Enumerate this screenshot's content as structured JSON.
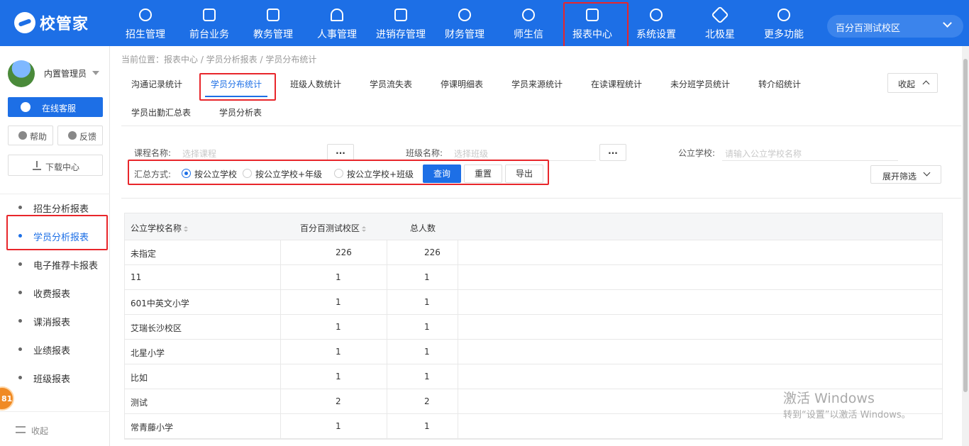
{
  "app": {
    "logo_text": "校管家",
    "campus": "百分百测试校区"
  },
  "nav": [
    {
      "label": "招生管理",
      "icon": "user-plus-icon"
    },
    {
      "label": "前台业务",
      "icon": "desk-icon"
    },
    {
      "label": "教务管理",
      "icon": "book-icon"
    },
    {
      "label": "人事管理",
      "icon": "person-icon"
    },
    {
      "label": "进销存管理",
      "icon": "inventory-icon"
    },
    {
      "label": "财务管理",
      "icon": "money-icon"
    },
    {
      "label": "师生信",
      "icon": "message-icon"
    },
    {
      "label": "报表中心",
      "icon": "report-icon"
    },
    {
      "label": "系统设置",
      "icon": "settings-icon"
    },
    {
      "label": "北极星",
      "icon": "star-icon"
    },
    {
      "label": "更多功能",
      "icon": "more-icon"
    }
  ],
  "sidebar": {
    "user": "内置管理员",
    "online_service": "在线客服",
    "help": "帮助",
    "feedback": "反馈",
    "download_center": "下载中心",
    "items": [
      "招生分析报表",
      "学员分析报表",
      "电子推荐卡报表",
      "收费报表",
      "课消报表",
      "业绩报表",
      "班级报表"
    ],
    "collapse": "收起",
    "badge": "81"
  },
  "breadcrumb": "当前位置：报表中心 / 学员分析报表 / 学员分布统计",
  "tabs": [
    "沟通记录统计",
    "学员分布统计",
    "班级人数统计",
    "学员流失表",
    "停课明细表",
    "学员来源统计",
    "在读课程统计",
    "未分班学员统计",
    "转介绍统计",
    "学员出勤汇总表",
    "学员分析表"
  ],
  "collapse_label": "收起",
  "filters": {
    "course_label": "课程名称:",
    "course_placeholder": "选择课程",
    "class_label": "班级名称:",
    "class_placeholder": "选择班级",
    "school_label": "公立学校:",
    "school_placeholder": "请输入公立学校名称",
    "dots": "...",
    "summary_label": "汇总方式:",
    "options": [
      "按公立学校",
      "按公立学校+年级",
      "按公立学校+班级"
    ],
    "query": "查询",
    "reset": "重置",
    "export": "导出",
    "expand": "展开筛选"
  },
  "table": {
    "headers": [
      "公立学校名称",
      "百分百测试校区",
      "总人数"
    ],
    "rows": [
      [
        "未指定",
        "226",
        "226"
      ],
      [
        "11",
        "1",
        "1"
      ],
      [
        "601中英文小学",
        "1",
        "1"
      ],
      [
        "艾瑞长沙校区",
        "1",
        "1"
      ],
      [
        "北星小学",
        "1",
        "1"
      ],
      [
        "比如",
        "1",
        "1"
      ],
      [
        "测试",
        "2",
        "2"
      ],
      [
        "常青藤小学",
        "1",
        "1"
      ]
    ]
  },
  "watermark": {
    "line1": "激活 Windows",
    "line2": "转到“设置”以激活 Windows。"
  }
}
